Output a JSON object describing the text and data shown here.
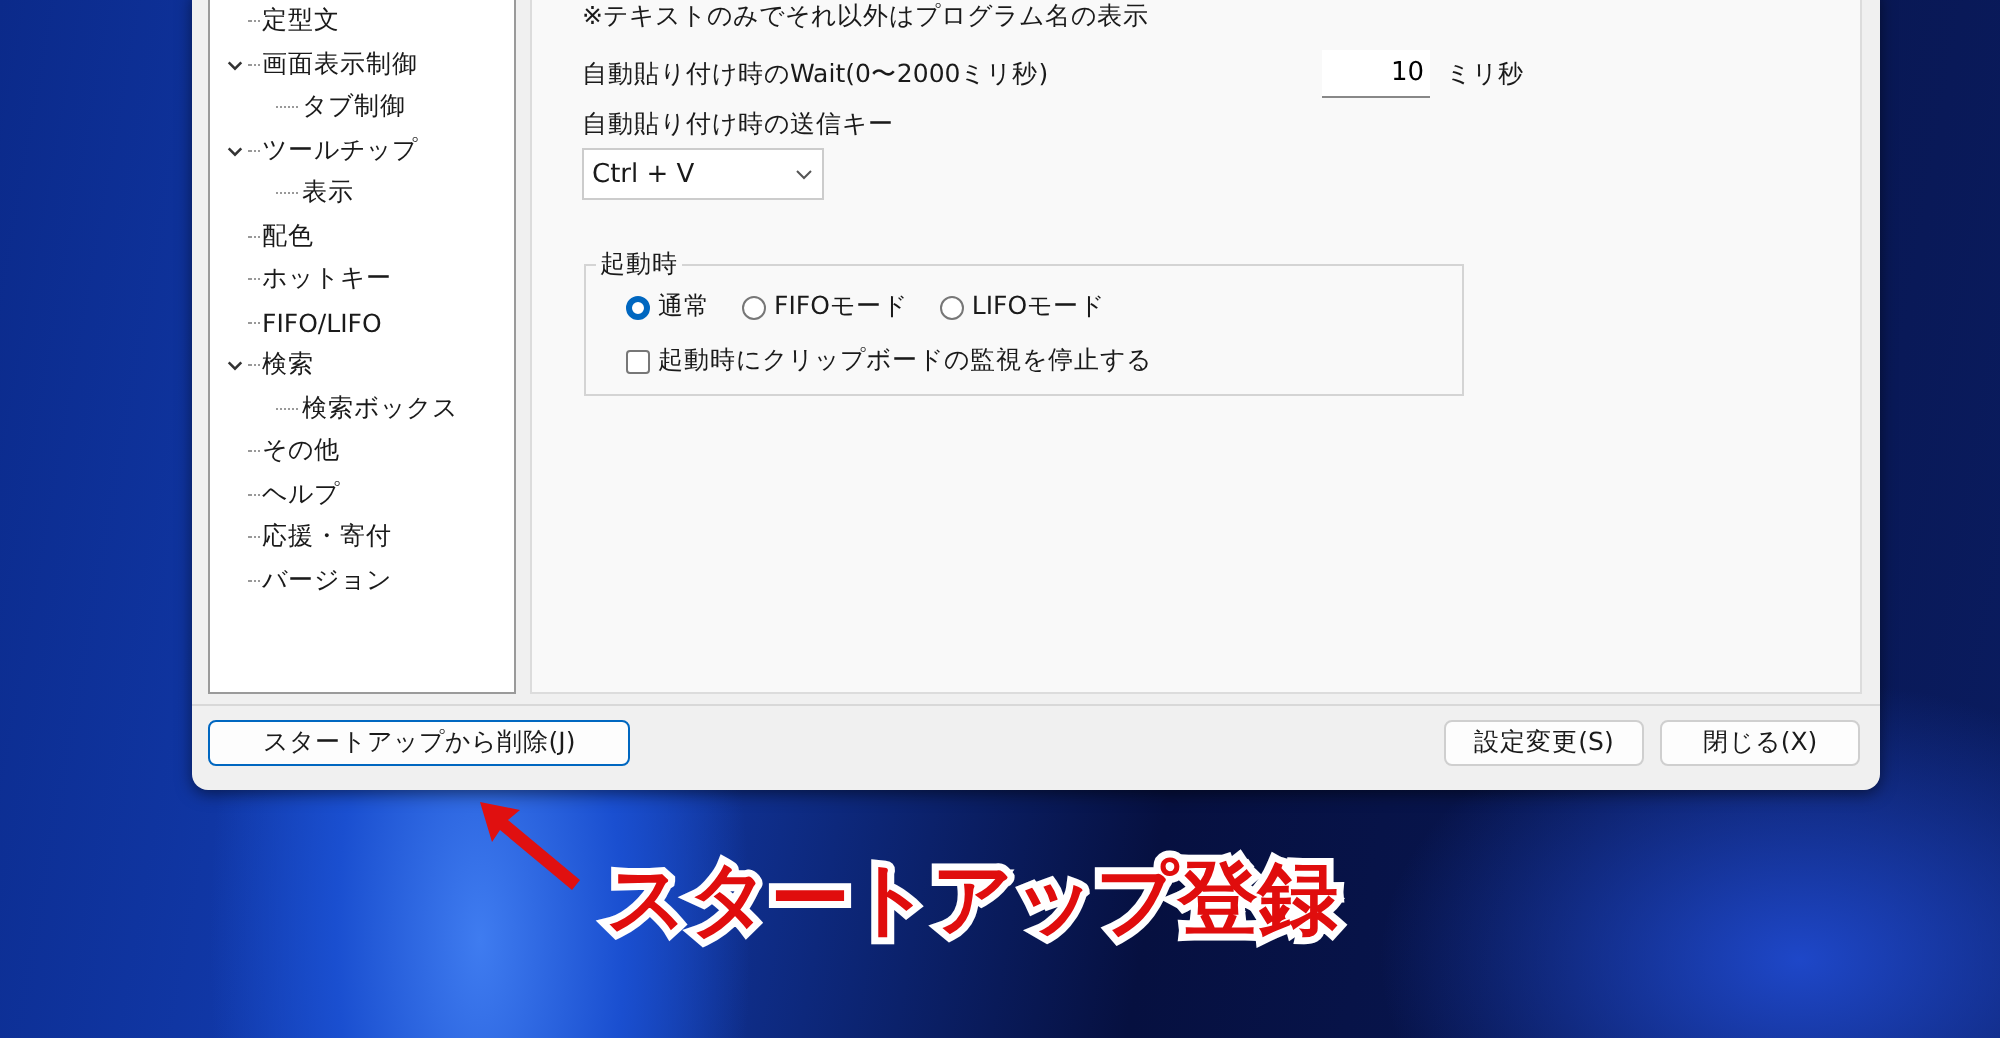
{
  "tree": {
    "items": [
      {
        "label": "定型文"
      },
      {
        "label": "画面表示制御",
        "expanded": true,
        "children": [
          {
            "label": "タブ制御"
          }
        ]
      },
      {
        "label": "ツールチップ",
        "expanded": true,
        "children": [
          {
            "label": "表示"
          }
        ]
      },
      {
        "label": "配色"
      },
      {
        "label": "ホットキー"
      },
      {
        "label": "FIFO/LIFO"
      },
      {
        "label": "検索",
        "expanded": true,
        "children": [
          {
            "label": "検索ボックス"
          }
        ]
      },
      {
        "label": "その他"
      },
      {
        "label": "ヘルプ"
      },
      {
        "label": "応援・寄付"
      },
      {
        "label": "バージョン"
      }
    ]
  },
  "content": {
    "note": "※テキストのみでそれ以外はプログラム名の表示",
    "wait": {
      "label": "自動貼り付け時のWait(0〜2000ミリ秒)",
      "value": "10",
      "unit": "ミリ秒"
    },
    "send_key": {
      "label": "自動貼り付け時の送信キー",
      "value": "Ctrl + V"
    },
    "startup_group": {
      "title": "起動時",
      "options": [
        {
          "label": "通常",
          "selected": true
        },
        {
          "label": "FIFOモード",
          "selected": false
        },
        {
          "label": "LIFOモード",
          "selected": false
        }
      ],
      "checkbox": {
        "label": "起動時にクリップボードの監視を停止する",
        "checked": false
      }
    }
  },
  "buttons": {
    "left": [
      {
        "label": "スタートアップから削除(J)",
        "focused": true
      }
    ],
    "right": [
      {
        "label": "設定変更(S)",
        "focused": false
      },
      {
        "label": "閉じる(X)",
        "focused": false
      }
    ]
  },
  "annotation": {
    "text": "スタートアップ登録"
  }
}
